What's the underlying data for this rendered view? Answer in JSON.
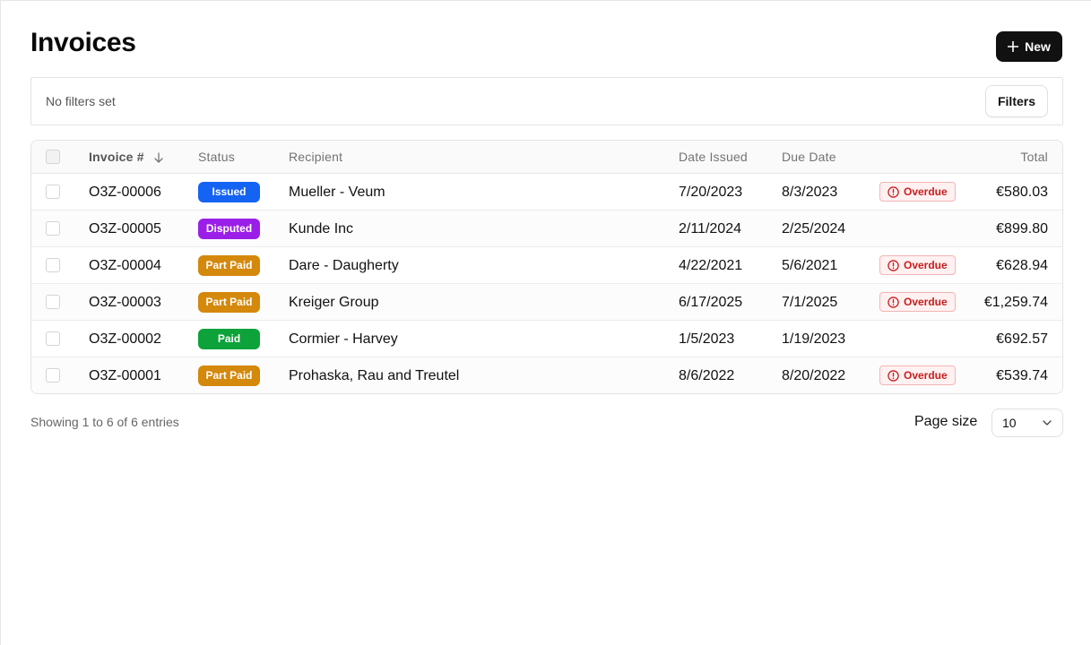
{
  "page": {
    "title": "Invoices",
    "new_button_label": "New"
  },
  "filters": {
    "status_text": "No filters set",
    "button_label": "Filters"
  },
  "table": {
    "columns": {
      "invoice": "Invoice #",
      "status": "Status",
      "recipient": "Recipient",
      "date_issued": "Date Issued",
      "due_date": "Due Date",
      "total": "Total"
    },
    "sort": {
      "column": "invoice",
      "direction": "descending",
      "icon": "arrow-down-icon"
    },
    "rows": [
      {
        "invoice": "O3Z-00006",
        "status": "Issued",
        "status_color": "#1463f3",
        "recipient": "Mueller - Veum",
        "date_issued": "7/20/2023",
        "due_date": "8/3/2023",
        "overdue": "Overdue",
        "total": "€580.03"
      },
      {
        "invoice": "O3Z-00005",
        "status": "Disputed",
        "status_color": "#9b1ee8",
        "recipient": "Kunde Inc",
        "date_issued": "2/11/2024",
        "due_date": "2/25/2024",
        "overdue": null,
        "total": "€899.80"
      },
      {
        "invoice": "O3Z-00004",
        "status": "Part Paid",
        "status_color": "#d4880c",
        "recipient": "Dare - Daugherty",
        "date_issued": "4/22/2021",
        "due_date": "5/6/2021",
        "overdue": "Overdue",
        "total": "€628.94"
      },
      {
        "invoice": "O3Z-00003",
        "status": "Part Paid",
        "status_color": "#d4880c",
        "recipient": "Kreiger Group",
        "date_issued": "6/17/2025",
        "due_date": "7/1/2025",
        "overdue": "Overdue",
        "total": "€1,259.74"
      },
      {
        "invoice": "O3Z-00002",
        "status": "Paid",
        "status_color": "#0ea23a",
        "recipient": "Cormier - Harvey",
        "date_issued": "1/5/2023",
        "due_date": "1/19/2023",
        "overdue": null,
        "total": "€692.57"
      },
      {
        "invoice": "O3Z-00001",
        "status": "Part Paid",
        "status_color": "#d4880c",
        "recipient": "Prohaska, Rau and Treutel",
        "date_issued": "8/6/2022",
        "due_date": "8/20/2022",
        "overdue": "Overdue",
        "total": "€539.74"
      }
    ]
  },
  "footer": {
    "entries_text": "Showing 1 to 6 of 6 entries",
    "page_size_label": "Page size",
    "page_size_value": "10"
  },
  "colors": {
    "primary_button": "#111111",
    "overdue_text": "#c81e1e",
    "overdue_border": "#f3b5b5",
    "overdue_bg": "#fff1f1"
  }
}
